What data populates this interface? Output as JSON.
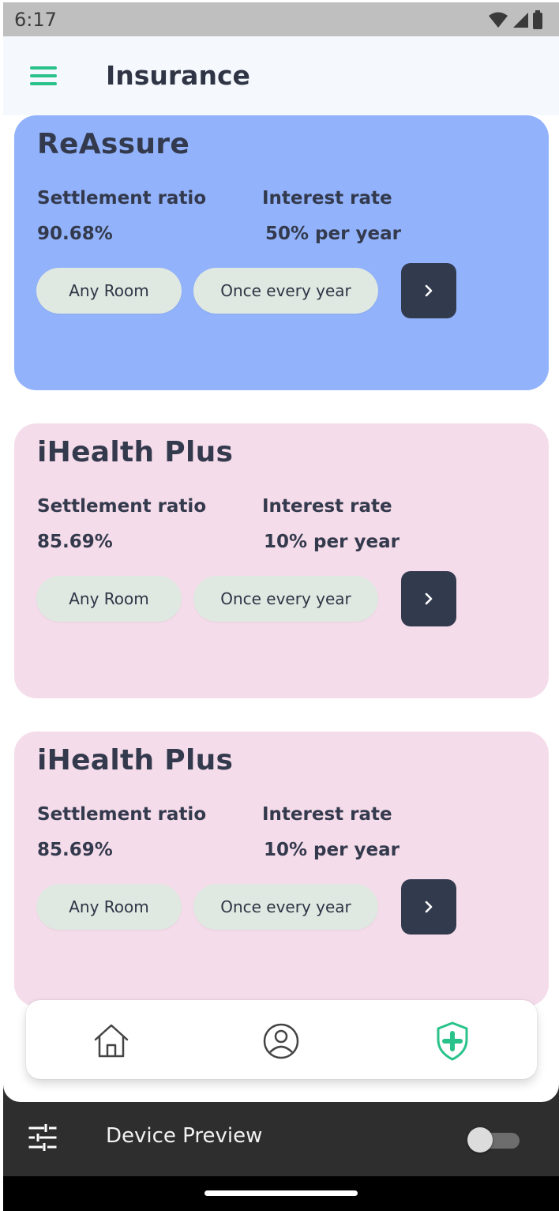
{
  "status_bar": {
    "time": "6:17",
    "icons": [
      "wifi-icon",
      "cellular-icon",
      "battery-icon"
    ]
  },
  "app_bar": {
    "menu_icon": "hamburger-menu-icon",
    "title": "Insurance"
  },
  "colors": {
    "accent": "#28c28a",
    "text_dark": "#343a4d",
    "card_blue": "#92b3fb",
    "card_pink": "#f5dcea",
    "chip_bg": "#dfe8e1",
    "button_dark": "#323a4e"
  },
  "cards": [
    {
      "name": "ReAssure",
      "settlement_label": "Settlement ratio",
      "settlement_value": "90.68%",
      "interest_label": "Interest rate",
      "interest_value": "50% per year",
      "chip_room": "Any Room",
      "chip_frequency": "Once every year",
      "background": "#92b3fb"
    },
    {
      "name": "iHealth Plus",
      "settlement_label": "Settlement ratio",
      "settlement_value": "85.69%",
      "interest_label": "Interest rate",
      "interest_value": "10% per year",
      "chip_room": "Any Room",
      "chip_frequency": "Once every year",
      "background": "#f5dcea"
    },
    {
      "name": "iHealth Plus",
      "settlement_label": "Settlement ratio",
      "settlement_value": "85.69%",
      "interest_label": "Interest rate",
      "interest_value": "10% per year",
      "chip_room": "Any Room",
      "chip_frequency": "Once every year",
      "background": "#f5dcea"
    }
  ],
  "bottom_nav": {
    "items": [
      {
        "icon": "home-icon",
        "active": false
      },
      {
        "icon": "profile-icon",
        "active": false
      },
      {
        "icon": "shield-plus-icon",
        "active": true
      }
    ]
  },
  "device_preview": {
    "label": "Device Preview",
    "enabled": false
  }
}
